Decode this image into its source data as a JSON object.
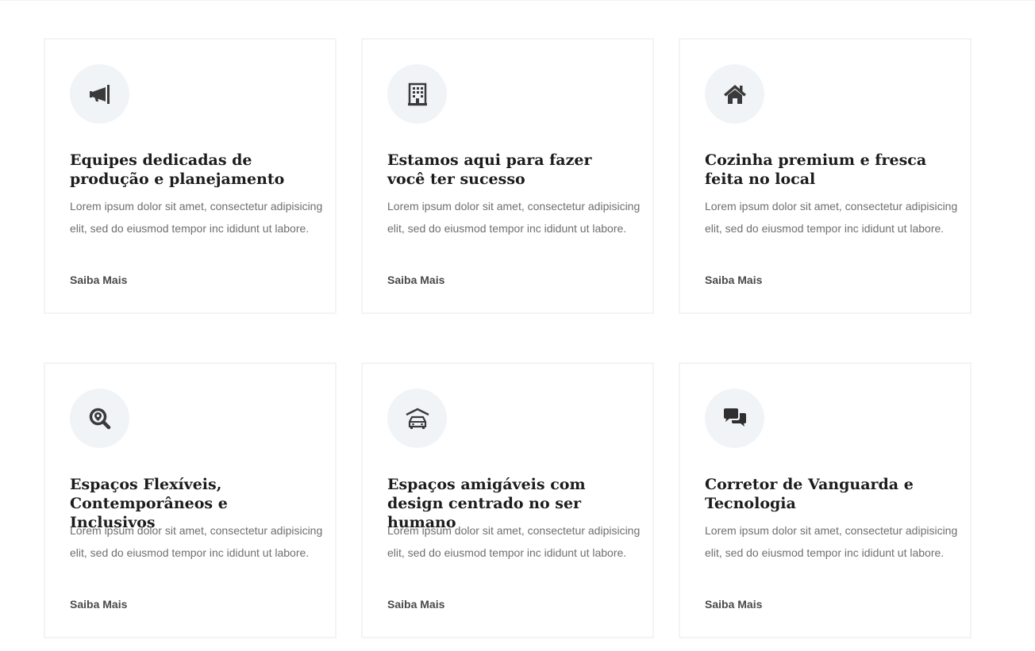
{
  "features": {
    "cards": [
      {
        "icon": "megaphone-icon",
        "title": "Equipes dedicadas de produção e planejamento",
        "description": "Lorem ipsum dolor sit amet, consectetur adipisicing elit, sed do eiusmod tempor inc ididunt ut labore.",
        "link": "Saiba Mais"
      },
      {
        "icon": "building-icon",
        "title": "Estamos aqui para fazer você ter sucesso",
        "description": "Lorem ipsum dolor sit amet, consectetur adipisicing elit, sed do eiusmod tempor inc ididunt ut labore.",
        "link": "Saiba Mais"
      },
      {
        "icon": "house-icon",
        "title": "Cozinha premium e fresca feita no local",
        "description": "Lorem ipsum dolor sit amet, consectetur adipisicing elit, sed do eiusmod tempor inc ididunt ut labore.",
        "link": "Saiba Mais"
      },
      {
        "icon": "search-location-icon",
        "title": "Espaços Flexíveis, Contemporâneos e Inclusivos",
        "description": "Lorem ipsum dolor sit amet, consectetur adipisicing elit, sed do eiusmod tempor inc ididunt ut labore.",
        "link": "Saiba Mais"
      },
      {
        "icon": "garage-car-icon",
        "title": "Espaços amigáveis com design centrado no ser humano",
        "description": "Lorem ipsum dolor sit amet, consectetur adipisicing elit, sed do eiusmod tempor inc ididunt ut labore.",
        "link": "Saiba Mais"
      },
      {
        "icon": "chat-bubbles-icon",
        "title": "Corretor de Vanguarda e Tecnologia",
        "description": "Lorem ipsum dolor sit amet, consectetur adipisicing elit, sed do eiusmod tempor inc ididunt ut labore.",
        "link": "Saiba Mais"
      }
    ]
  },
  "colors": {
    "icon_bg": "#f1f4f7",
    "icon_fill": "#3a3a3a",
    "title": "#1c1c1c",
    "text": "#6f6f6f",
    "border": "#f3f4f5"
  }
}
